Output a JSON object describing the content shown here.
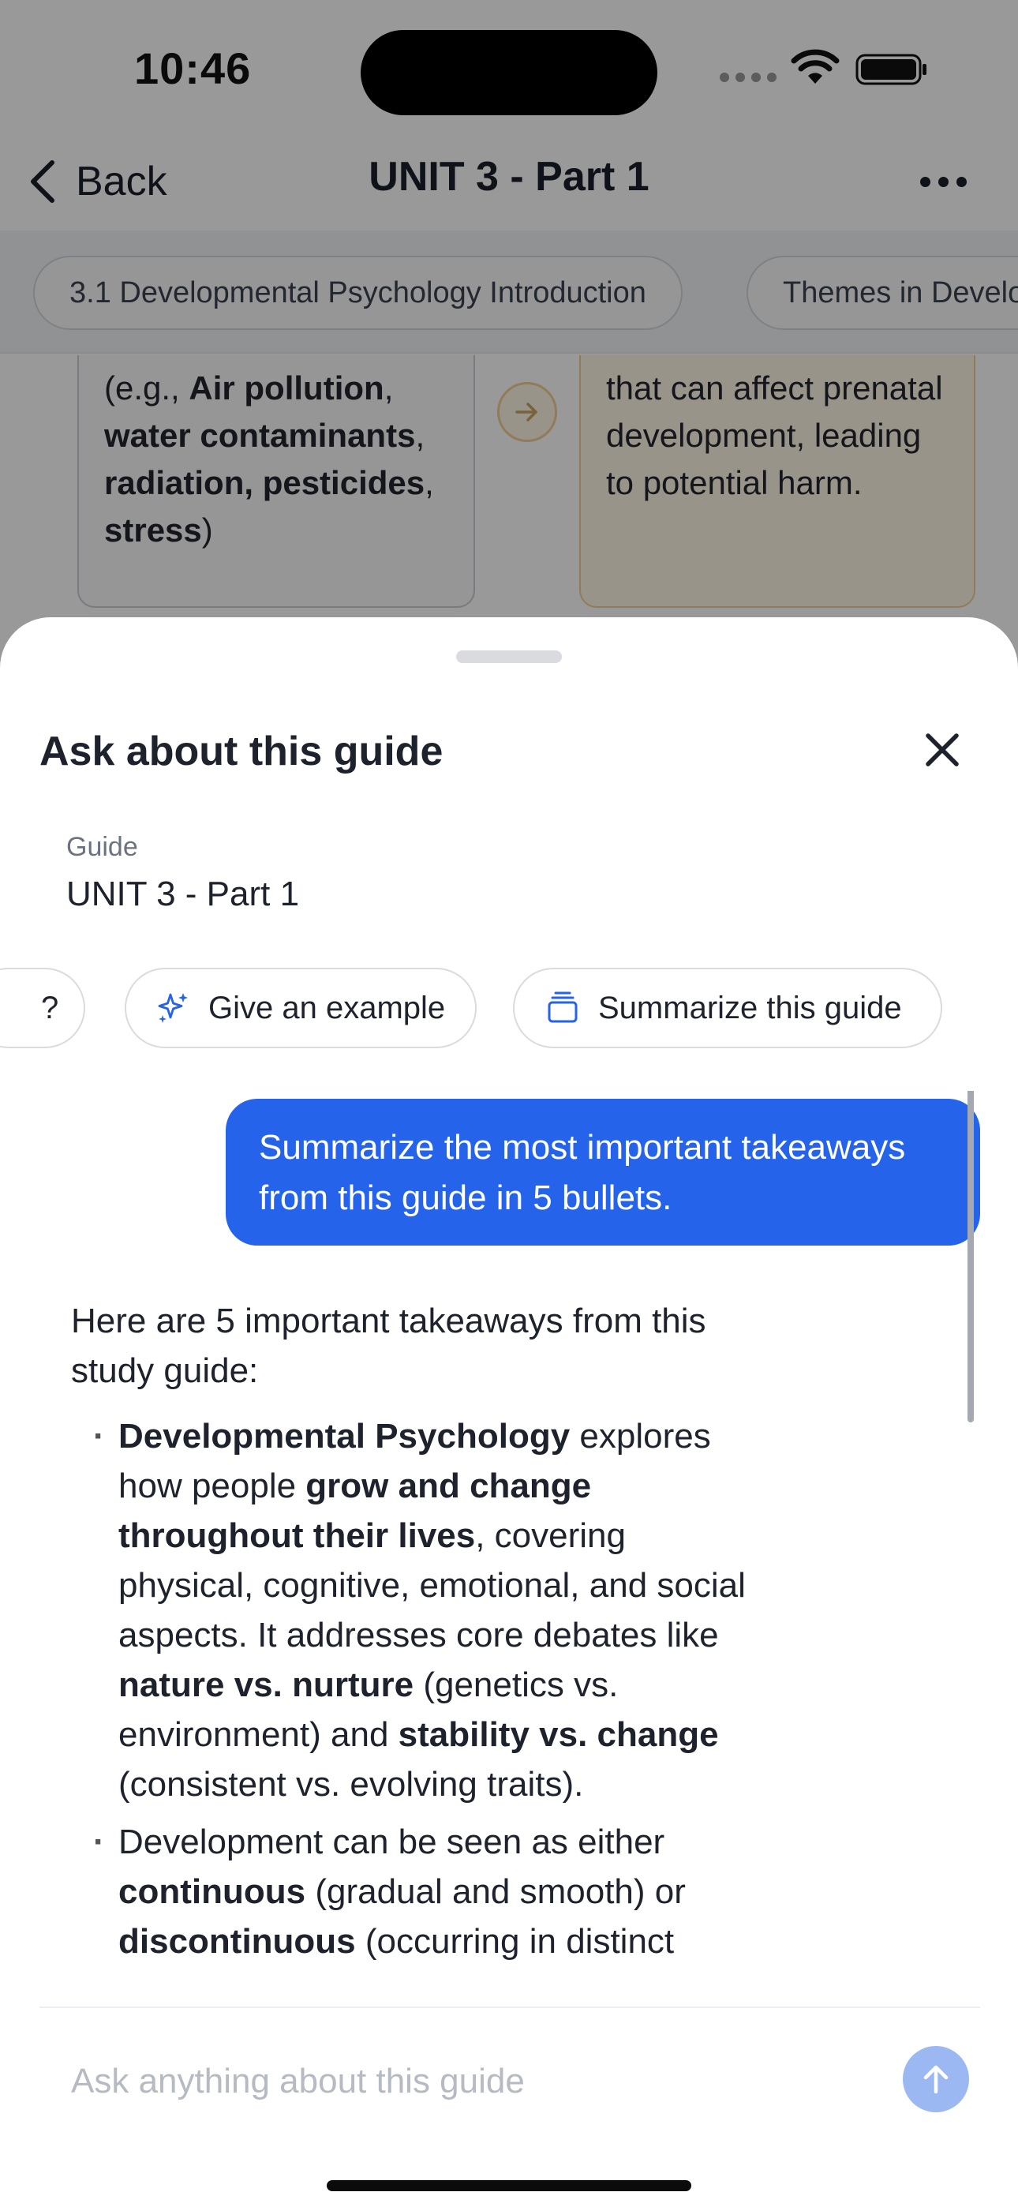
{
  "status_bar": {
    "time": "10:46"
  },
  "nav": {
    "back_label": "Back",
    "title": "UNIT 3 - Part 1"
  },
  "topic_chips": [
    "3.1 Developmental Psychology Introduction",
    "Themes in Developmental Psychology"
  ],
  "background_cards": {
    "left": {
      "prefix": "(e.g., ",
      "bold_1": "Air pollution",
      "sep_1": ",",
      "bold_2": "water contaminants",
      "sep_2": ",",
      "bold_3": "radiation, pesticides",
      "sep_3": ",",
      "bold_4": "stress",
      "suffix": ")"
    },
    "right": {
      "text": "that can affect prenatal development, leading to potential harm."
    }
  },
  "sheet": {
    "title": "Ask about this guide",
    "guide_label": "Guide",
    "guide_name": "UNIT 3 - Part 1",
    "suggestions": [
      {
        "label": "?",
        "icon": "question-icon"
      },
      {
        "label": "Give an example",
        "icon": "sparkle-icon"
      },
      {
        "label": "Summarize this guide",
        "icon": "stack-icon"
      }
    ],
    "input_placeholder": "Ask anything about this guide"
  },
  "chat": {
    "user_message": "Summarize the most important takeaways from this guide in 5 bullets.",
    "answer_intro": "Here are 5 important takeaways from this study guide:",
    "bullet_1": {
      "b1": "Developmental Psychology",
      "t1": " explores how people ",
      "b2": "grow and change throughout their lives",
      "t2": ", covering physical, cognitive, emotional, and social aspects. It addresses core debates like ",
      "b3": "nature vs. nurture",
      "t3": " (genetics vs. environment) and ",
      "b4": "stability vs. change",
      "t4": " (consistent vs. evolving traits)."
    },
    "bullet_2": {
      "t1": "Development can be seen as either ",
      "b1": "continuous",
      "t2": " (gradual and smooth) or ",
      "b2": "discontinuous",
      "t3": " (occurring in distinct"
    }
  },
  "colors": {
    "accent": "#2563eb",
    "send_disabled": "#9bb8f3",
    "card_warm": "#fff7e6"
  }
}
